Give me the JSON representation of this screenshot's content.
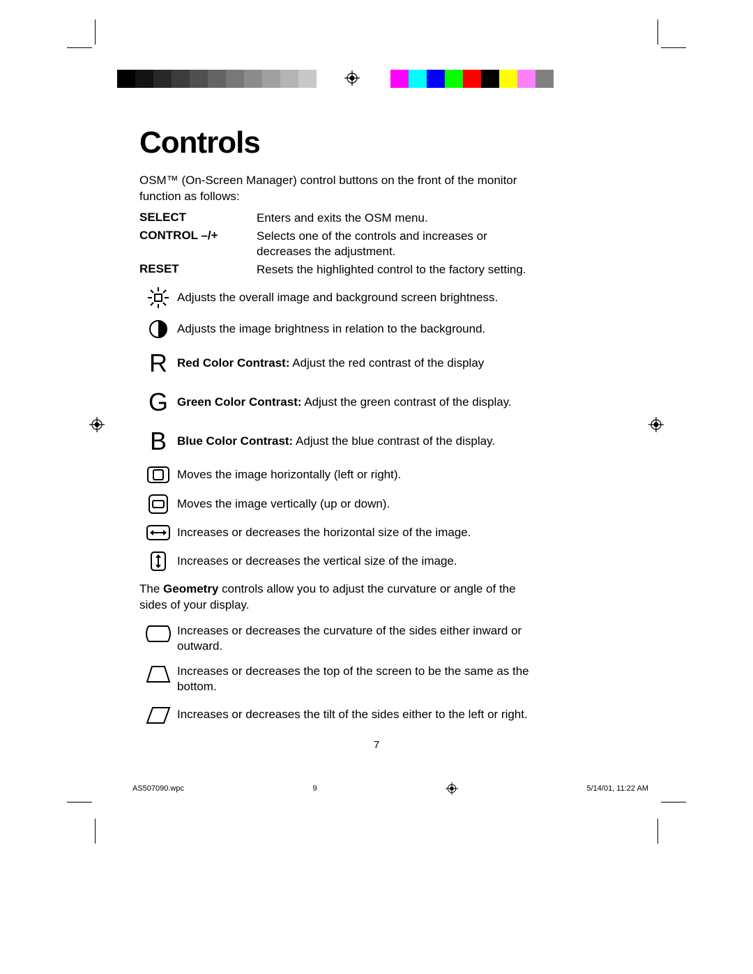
{
  "title": "Controls",
  "intro": "OSM™ (On-Screen Manager) control buttons on the front of the monitor function as follows:",
  "buttons": [
    {
      "label": "SELECT",
      "desc": "Enters and exits the OSM menu."
    },
    {
      "label": "CONTROL  –/+",
      "desc": "Selects one of the controls and increases or decreases the adjustment."
    },
    {
      "label": "RESET",
      "desc": "Resets the highlighted control to the factory setting."
    }
  ],
  "controls1": [
    {
      "key": "brightness",
      "desc_bold": "",
      "desc": "Adjusts the overall image and background screen brightness."
    },
    {
      "key": "contrast",
      "desc_bold": "",
      "desc": "Adjusts the image brightness in relation to the background."
    },
    {
      "key": "R",
      "desc_bold": "Red Color Contrast:",
      "desc": " Adjust the red contrast of the display"
    },
    {
      "key": "G",
      "desc_bold": "Green Color Contrast:",
      "desc": " Adjust the green contrast of the display."
    },
    {
      "key": "B",
      "desc_bold": "Blue Color Contrast:",
      "desc": " Adjust the blue contrast of the display."
    },
    {
      "key": "hpos",
      "desc_bold": "",
      "desc": "Moves the image horizontally (left or right)."
    },
    {
      "key": "vpos",
      "desc_bold": "",
      "desc": "Moves the image vertically (up or down)."
    },
    {
      "key": "hsize",
      "desc_bold": "",
      "desc": "Increases or decreases the horizontal size of the image."
    },
    {
      "key": "vsize",
      "desc_bold": "",
      "desc": "Increases or decreases the vertical size of the image."
    }
  ],
  "geometry_para_pre": "The ",
  "geometry_para_bold": "Geometry",
  "geometry_para_post": " controls allow you to adjust the curvature or angle of the sides of your display.",
  "controls2": [
    {
      "key": "pincushion",
      "desc": "Increases or decreases the curvature of the sides either inward or outward."
    },
    {
      "key": "trapezoid",
      "desc": "Increases or decreases the top of the screen to be the same as the bottom."
    },
    {
      "key": "parallelogram",
      "desc": "Increases or decreases the tilt of the sides either to the left or right."
    }
  ],
  "page_number": "7",
  "slug": {
    "file": "AS507090.wpc",
    "sheet": "9",
    "datetime": "5/14/01, 11:22 AM"
  },
  "colorbar_gray": [
    "#000000",
    "#141414",
    "#282828",
    "#3c3c3c",
    "#505050",
    "#646464",
    "#787878",
    "#8c8c8c",
    "#a0a0a0",
    "#b4b4b4",
    "#c8c8c8",
    "#ffffff"
  ],
  "colorbar_color": [
    "#ff00ff",
    "#00ffff",
    "#0000ff",
    "#00ff00",
    "#ff0000",
    "#000000",
    "#ffff00",
    "#ff80ff",
    "#808080",
    "#ffffff"
  ]
}
